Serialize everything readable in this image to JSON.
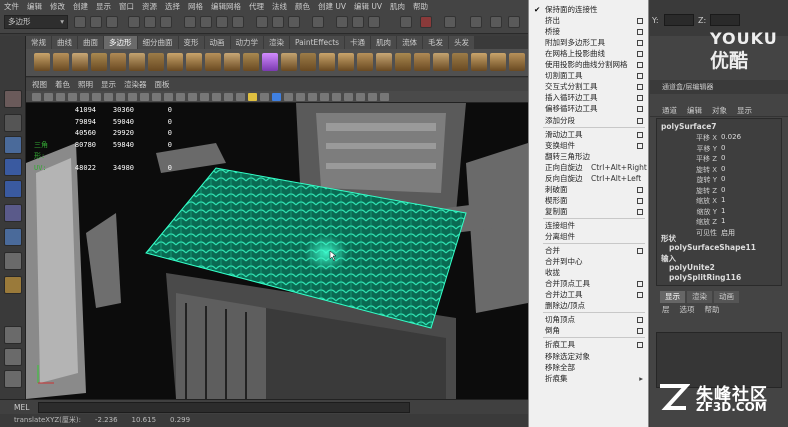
{
  "menubar": [
    "文件",
    "编辑",
    "修改",
    "创建",
    "显示",
    "窗口",
    "资源",
    "选择",
    "网格",
    "编辑网格",
    "代理",
    "法线",
    "颜色",
    "创建 UV",
    "编辑 UV",
    "肌肉",
    "帮助"
  ],
  "mode_selector": "多边形",
  "shelf_tabs": [
    "常规",
    "曲线",
    "曲面",
    "多边形",
    "细分曲面",
    "变形",
    "动画",
    "动力学",
    "渲染",
    "PaintEffects",
    "卡通",
    "肌肉",
    "流体",
    "毛发",
    "头发"
  ],
  "shelf_active": "多边形",
  "viewport_menu": [
    "视图",
    "着色",
    "照明",
    "显示",
    "渲染器",
    "面板"
  ],
  "hud": {
    "rows": [
      {
        "label": "",
        "a": "41094",
        "b": "30360",
        "c": "0"
      },
      {
        "label": "",
        "a": "79894",
        "b": "59040",
        "c": "0"
      },
      {
        "label": "",
        "a": "40560",
        "b": "29920",
        "c": "0"
      },
      {
        "label": "三角形:",
        "a": "80780",
        "b": "59840",
        "c": "0"
      },
      {
        "label": "UV:",
        "a": "48022",
        "b": "34980",
        "c": "0"
      }
    ]
  },
  "mel_label": "MEL",
  "help_line": {
    "label": "translateXYZ(厘米):",
    "x": "-2.236",
    "y": "10.615",
    "z": "0.299"
  },
  "context_menu": [
    {
      "label": "保持面的连接性",
      "checked": true
    },
    {
      "label": "挤出",
      "opt": true
    },
    {
      "label": "桥接",
      "opt": true
    },
    {
      "label": "附加到多边形工具",
      "opt": true
    },
    {
      "label": "在网格上投影曲线",
      "opt": true
    },
    {
      "label": "使用投影的曲线分割网格",
      "opt": true
    },
    {
      "label": "切割面工具",
      "opt": true
    },
    {
      "label": "交互式分割工具",
      "opt": true
    },
    {
      "label": "插入循环边工具",
      "opt": true
    },
    {
      "label": "偏移循环边工具",
      "opt": true
    },
    {
      "label": "添加分段",
      "opt": true
    },
    {
      "sep": true
    },
    {
      "label": "滑动边工具",
      "opt": true
    },
    {
      "label": "变换组件",
      "opt": true
    },
    {
      "label": "翻转三角形边"
    },
    {
      "label": "正向自旋边",
      "shortcut": "Ctrl+Alt+Right"
    },
    {
      "label": "反向自旋边",
      "shortcut": "Ctrl+Alt+Left"
    },
    {
      "label": "刺破面",
      "opt": true
    },
    {
      "label": "楔形面",
      "opt": true
    },
    {
      "label": "复制面",
      "opt": true
    },
    {
      "sep": true
    },
    {
      "label": "连接组件"
    },
    {
      "label": "分离组件"
    },
    {
      "sep": true
    },
    {
      "label": "合并",
      "opt": true
    },
    {
      "label": "合并到中心"
    },
    {
      "label": "收拢"
    },
    {
      "label": "合并顶点工具",
      "opt": true
    },
    {
      "label": "合并边工具",
      "opt": true
    },
    {
      "label": "删除边/顶点"
    },
    {
      "sep": true
    },
    {
      "label": "切角顶点",
      "opt": true
    },
    {
      "label": "倒角",
      "opt": true
    },
    {
      "sep": true
    },
    {
      "label": "折痕工具",
      "opt": true
    },
    {
      "label": "移除选定对象"
    },
    {
      "label": "移除全部"
    },
    {
      "label": "折痕集",
      "sub": true
    }
  ],
  "right_panel": {
    "coord_labels": [
      "Y:",
      "Z:"
    ],
    "header": "通道盒/层编辑器",
    "menu": [
      "通道",
      "编辑",
      "对象",
      "显示"
    ],
    "object_name": "polySurface7",
    "channels": [
      {
        "label": "平移 X",
        "value": "0.026"
      },
      {
        "label": "平移 Y",
        "value": "0"
      },
      {
        "label": "平移 Z",
        "value": "0"
      },
      {
        "label": "旋转 X",
        "value": "0"
      },
      {
        "label": "旋转 Y",
        "value": "0"
      },
      {
        "label": "旋转 Z",
        "value": "0"
      },
      {
        "label": "缩放 X",
        "value": "1"
      },
      {
        "label": "缩放 Y",
        "value": "1"
      },
      {
        "label": "缩放 Z",
        "value": "1"
      },
      {
        "label": "可见性",
        "value": "启用"
      }
    ],
    "shapes_label": "形状",
    "shape_name": "polySurfaceShape11",
    "inputs_label": "输入",
    "inputs": [
      "polyUnite2",
      "polySplitRing116"
    ],
    "layer_tabs": [
      "显示",
      "渲染",
      "动画"
    ],
    "layer_menu": [
      "层",
      "选项",
      "帮助"
    ]
  },
  "watermark": {
    "logo_en": "YOUKU",
    "logo_cn": "优酷",
    "site_cn": "朱峰社区",
    "site_en": "ZF3D.COM"
  }
}
